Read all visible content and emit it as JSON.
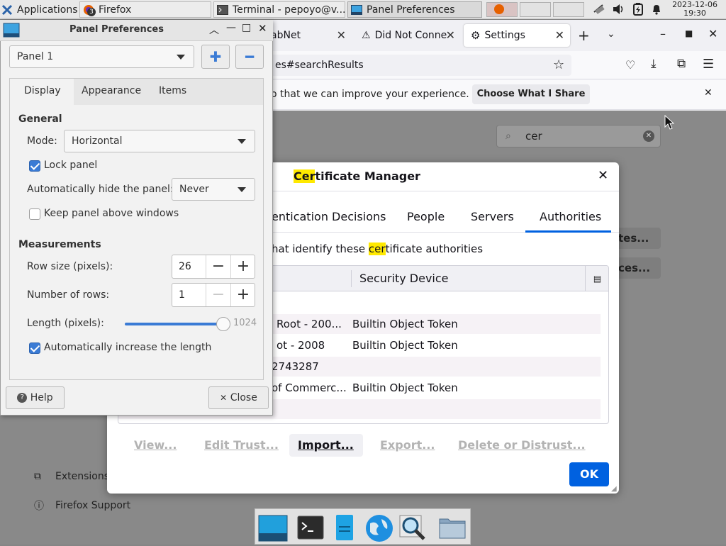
{
  "top_panel": {
    "applications_label": "Applications",
    "firefox_label": "Firefox",
    "firefox_badge": "3",
    "terminal_label": "Terminal - pepoyo@v...",
    "panel_prefs_label": "Panel Preferences",
    "clock_date": "2023-12-06",
    "clock_time": "19:30"
  },
  "firefox": {
    "tabs": [
      {
        "label": "abNet"
      },
      {
        "label": "Did Not Conne"
      },
      {
        "label": "Settings"
      }
    ],
    "url": "es#searchResults",
    "notification_text": "o that we can improve your experience.",
    "notification_button": "Choose What I Share",
    "search_value": "cer",
    "sidebar": {
      "extensions": "Extensions",
      "support": "Firefox Support"
    },
    "bg_buttons": [
      "tes...",
      "ces..."
    ]
  },
  "cert_manager": {
    "title_hl": "Cer",
    "title_rest": "tificate Manager",
    "tabs": [
      {
        "label": "entication Decisions"
      },
      {
        "label": "People"
      },
      {
        "label": "Servers"
      },
      {
        "label": "Authorities"
      }
    ],
    "desc_pre": "hat identify these ",
    "desc_hl": "cer",
    "desc_post": "tificate authorities",
    "column_device": "Security Device",
    "rows": [
      {
        "name": "",
        "device": ""
      },
      {
        "name": "Root - 200...",
        "device": "Builtin Object Token"
      },
      {
        "name": "ot - 2008",
        "device": "Builtin Object Token"
      },
      {
        "name": "2743287",
        "device": ""
      },
      {
        "name": "of Commerc...",
        "device": "Builtin Object Token"
      },
      {
        "name": "",
        "device": ""
      }
    ],
    "buttons": {
      "view": "View...",
      "edit_trust": "Edit Trust...",
      "import": "Import...",
      "export": "Export...",
      "delete": "Delete or Distrust...",
      "ok": "OK"
    }
  },
  "panel_prefs": {
    "title": "Panel Preferences",
    "panel_select": "Panel 1",
    "tabs": {
      "display": "Display",
      "appearance": "Appearance",
      "items": "Items"
    },
    "general_heading": "General",
    "mode_label": "Mode:",
    "mode_value": "Horizontal",
    "lock_panel": "Lock panel",
    "autohide_label": "Automatically hide the panel:",
    "autohide_value": "Never",
    "keep_above": "Keep panel above windows",
    "measurements_heading": "Measurements",
    "row_size_label": "Row size (pixels):",
    "row_size_value": "26",
    "rows_label": "Number of rows:",
    "rows_value": "1",
    "length_label": "Length (pixels):",
    "length_value": "1024",
    "length_fraction": 1.0,
    "auto_increase": "Automatically increase the length",
    "help_button": "Help",
    "close_button": "Close"
  },
  "colors": {
    "accent": "#0061e0",
    "check": "#3a7bd5",
    "highlight": "#ffe900"
  }
}
